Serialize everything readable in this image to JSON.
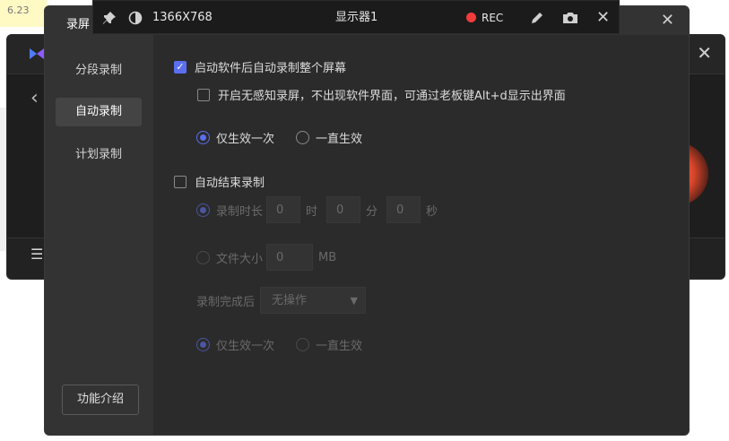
{
  "desktop": {
    "version_label": "6.23"
  },
  "toolbar": {
    "resolution": "1366X768",
    "display_name": "显示器1",
    "rec_label": "REC"
  },
  "dialog": {
    "title": "录屏",
    "close_glyph": "✕",
    "sidebar": {
      "items": [
        {
          "label": "分段录制",
          "active": false
        },
        {
          "label": "自动录制",
          "active": true
        },
        {
          "label": "计划录制",
          "active": false
        }
      ],
      "feature_button": "功能介绍"
    },
    "auto_start": {
      "label": "启动软件后自动录制整个屏幕",
      "checked": true,
      "silent_label": "开启无感知录屏，不出现软件界面，可通过老板键Alt+d显示出界面",
      "silent_checked": false,
      "once_label": "仅生效一次",
      "always_label": "一直生效",
      "selected": "once"
    },
    "auto_end": {
      "label": "自动结束录制",
      "checked": false,
      "duration_label": "录制时长",
      "hours": "0",
      "hours_unit": "时",
      "minutes": "0",
      "minutes_unit": "分",
      "seconds": "0",
      "seconds_unit": "秒",
      "filesize_label": "文件大小",
      "filesize": "0",
      "filesize_unit": "MB",
      "after_label": "录制完成后",
      "after_value": "无操作",
      "once_label": "仅生效一次",
      "always_label": "一直生效"
    }
  },
  "colors": {
    "accent": "#5b6ff0",
    "rec": "#f23c3c",
    "panel": "#2b2b2b"
  }
}
